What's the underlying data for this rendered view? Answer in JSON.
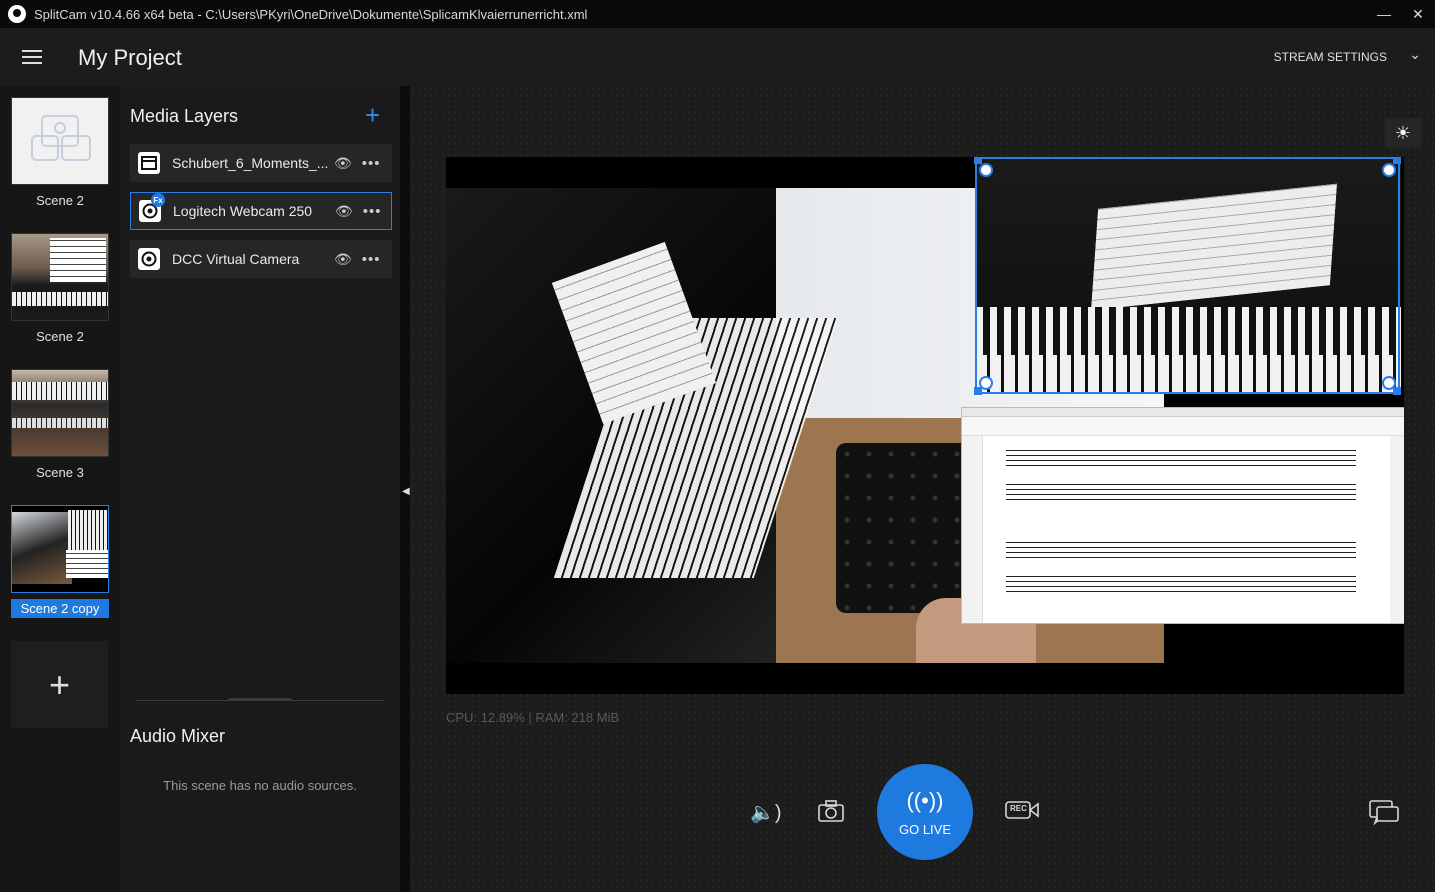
{
  "window": {
    "title": "SplitCam v10.4.66 x64 beta - C:\\Users\\PKyri\\OneDrive\\Dokumente\\SplicamKlvaierrunerricht.xml",
    "minimize": "—",
    "close": "✕"
  },
  "header": {
    "project_title": "My Project",
    "stream_settings": "STREAM SETTINGS"
  },
  "scenes": [
    {
      "label": "Scene 2"
    },
    {
      "label": "Scene 2"
    },
    {
      "label": "Scene 3"
    },
    {
      "label": "Scene 2 copy",
      "active": true
    }
  ],
  "layers": {
    "title": "Media Layers",
    "items": [
      {
        "name": "Schubert_6_Moments_..."
      },
      {
        "name": "Logitech Webcam 250",
        "badge": "Fx"
      },
      {
        "name": "DCC Virtual Camera"
      }
    ]
  },
  "audio": {
    "title": "Audio Mixer",
    "empty": "This scene has no audio sources."
  },
  "stats": {
    "text": "CPU: 12.89% | RAM: 218 MiB"
  },
  "controls": {
    "go_live": "GO LIVE",
    "rec": "REC"
  },
  "colors": {
    "accent": "#1f7ae0",
    "background": "#141414"
  }
}
